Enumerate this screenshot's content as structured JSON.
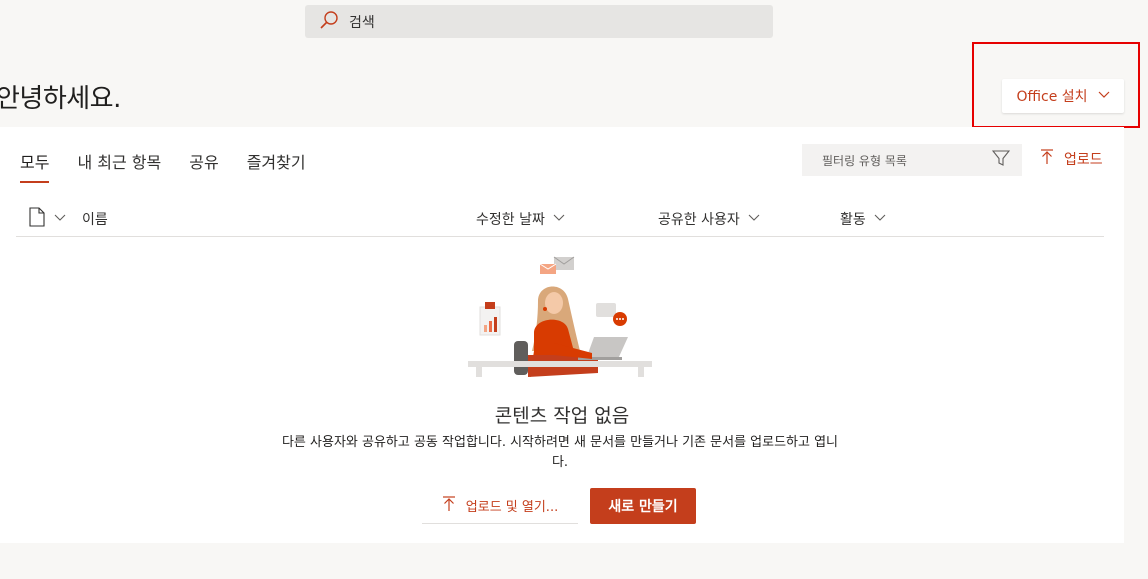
{
  "search": {
    "placeholder": "검색"
  },
  "greeting": "안녕하세요.",
  "install": {
    "label": "Office 설치"
  },
  "tabs": [
    {
      "label": "모두",
      "active": true
    },
    {
      "label": "내 최근 항목",
      "active": false
    },
    {
      "label": "공유",
      "active": false
    },
    {
      "label": "즐겨찾기",
      "active": false
    }
  ],
  "filter": {
    "placeholder": "필터링 유형 목록"
  },
  "upload": {
    "label": "업로드"
  },
  "columns": {
    "name": "이름",
    "modified": "수정한 날짜",
    "shared_by": "공유한 사용자",
    "activity": "활동"
  },
  "empty_state": {
    "title": "콘텐츠 작업 없음",
    "description": "다른 사용자와 공유하고 공동 작업합니다. 시작하려면 새 문서를 만들거나 기존 문서를 업로드하고 엽니다.",
    "upload_open_label": "업로드 및 열기...",
    "create_new_label": "새로 만들기"
  },
  "colors": {
    "accent": "#c43e1c",
    "highlight_box": "#e60000"
  },
  "icons": {
    "search": "search-icon",
    "chevron": "chevron-down-icon",
    "filter": "filter-icon",
    "upload": "upload-arrow-icon",
    "file": "file-icon"
  }
}
